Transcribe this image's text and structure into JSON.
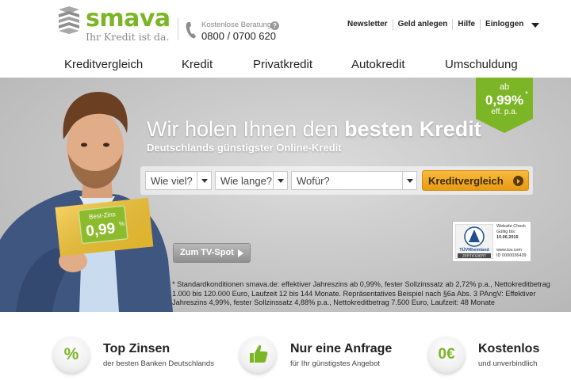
{
  "brand": {
    "name": "smava",
    "tagline": "Ihr Kredit ist da.",
    "green": "#7cb526"
  },
  "contact": {
    "label": "Kostenlose Beratung",
    "help_icon": "?",
    "phone": "0800 / 0700 620"
  },
  "topnav": {
    "newsletter": "Newsletter",
    "invest": "Geld anlegen",
    "help": "Hilfe",
    "login": "Einloggen"
  },
  "mainnav": {
    "items": [
      "Kreditvergleich",
      "Kredit",
      "Privatkredit",
      "Autokredit",
      "Umschuldung"
    ]
  },
  "hero": {
    "title_regular": "Wir holen Ihnen den ",
    "title_bold": "besten Kredit",
    "subtitle": "Deutschlands günstigster Online-Kredit",
    "card_label": "Best-Zins",
    "card_rate": "0,99",
    "card_pct": "%",
    "badge": {
      "prefix": "ab",
      "rate": "0,99%",
      "star": "*",
      "suffix": "eff. p.a."
    },
    "search": {
      "amount_placeholder": "Wie viel?",
      "duration_placeholder": "Wie lange?",
      "purpose_placeholder": "Wofür?",
      "cta_label": "Kreditvergleich"
    },
    "tv_button": "Zum TV-Spot",
    "tuv": {
      "name": "TÜVRheinland",
      "certified": "ZERTIFIZIERT",
      "line1": "Website Check",
      "line2": "Gültig bis:",
      "line3": "10.06.2015",
      "line4": "www.tuv.com",
      "line5": "ID 0000036439"
    },
    "footnote": "* Standardkonditionen smava.de: effektiver Jahreszins ab 0,99%, fester Sollzinssatz ab 2,72% p.a., Nettokreditbetrag 1.000 bis 120.000 Euro, Laufzeit 12 bis 144 Monate. Repräsentatives Beispiel nach §6a Abs. 3 PAngV: Effektiver Jahreszins 4,99%, fester Sollzinssatz 4,88% p.a., Nettokreditbetrag 7.500 Euro, Laufzeit: 48 Monate"
  },
  "features": [
    {
      "icon": "percent-icon",
      "glyph": "%",
      "title": "Top Zinsen",
      "desc": "der besten Banken Deutschlands"
    },
    {
      "icon": "thumbs-up-icon",
      "glyph": "",
      "title": "Nur eine Anfrage",
      "desc": "für Ihr günstigstes Angebot"
    },
    {
      "icon": "zero-euro-icon",
      "glyph": "0€",
      "title": "Kostenlos",
      "desc": "und unverbindlich"
    }
  ]
}
